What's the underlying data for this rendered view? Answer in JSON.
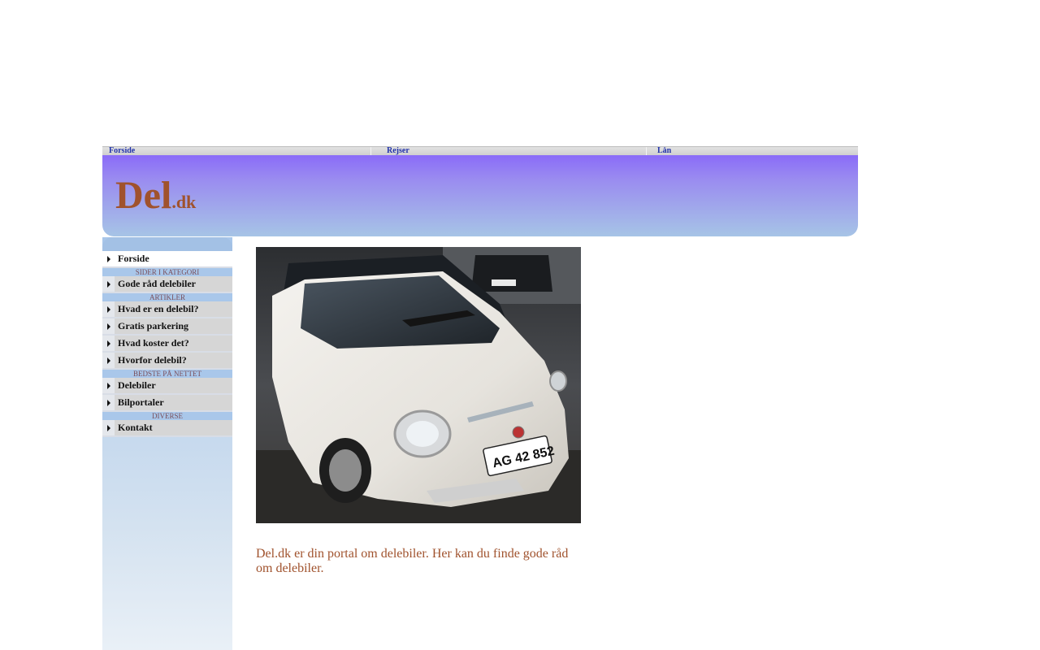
{
  "top_nav": {
    "links": [
      "Forside",
      "Rejser",
      "Lån"
    ]
  },
  "logo": {
    "main": "Del",
    "ext": ".dk"
  },
  "sidebar": {
    "items": [
      {
        "type": "link",
        "label": "Forside",
        "active": true
      },
      {
        "type": "category",
        "label": "SIDER I KATEGORI"
      },
      {
        "type": "link",
        "label": "Gode råd delebiler"
      },
      {
        "type": "category",
        "label": "ARTIKLER"
      },
      {
        "type": "link",
        "label": "Hvad er en delebil?"
      },
      {
        "type": "link",
        "label": "Gratis parkering"
      },
      {
        "type": "link",
        "label": "Hvad koster det?"
      },
      {
        "type": "link",
        "label": "Hvorfor delebil?"
      },
      {
        "type": "category",
        "label": "BEDSTE PÅ NETTET"
      },
      {
        "type": "link",
        "label": "Delebiler"
      },
      {
        "type": "link",
        "label": "Bilportaler"
      },
      {
        "type": "category",
        "label": "DIVERSE"
      },
      {
        "type": "link",
        "label": "Kontakt"
      }
    ]
  },
  "hero": {
    "plate_text": "AG 42 852"
  },
  "main": {
    "intro": "Del.dk er din portal om delebiler. Her kan du finde gode råd om delebiler."
  },
  "colors": {
    "brand": "#a0522d",
    "nav_link": "#2233aa",
    "banner_top": "#8a6bf8",
    "banner_bottom": "#a6c4e6"
  }
}
